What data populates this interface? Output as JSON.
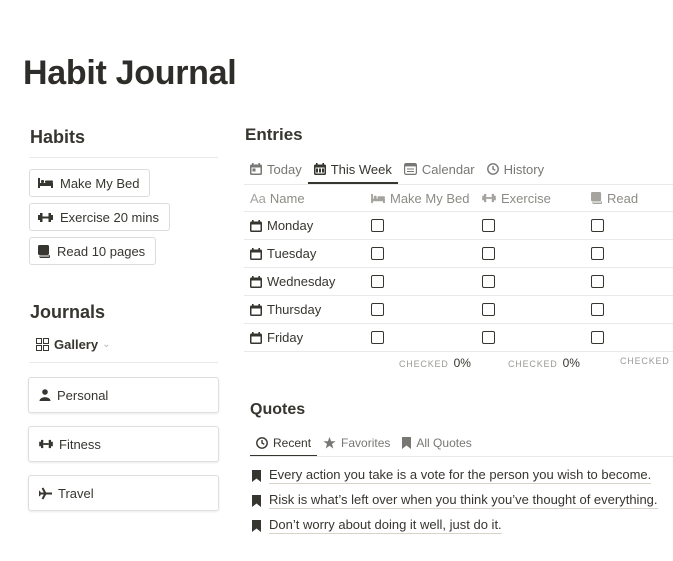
{
  "page": {
    "title": "Habit Journal"
  },
  "habits": {
    "heading": "Habits",
    "buttons": [
      {
        "label": "Make My Bed",
        "icon": "bed-icon"
      },
      {
        "label": "Exercise 20 mins",
        "icon": "dumbbell-icon"
      },
      {
        "label": "Read 10 pages",
        "icon": "book-icon"
      }
    ]
  },
  "journals": {
    "heading": "Journals",
    "view": "Gallery",
    "cards": [
      {
        "label": "Personal",
        "icon": "person-icon"
      },
      {
        "label": "Fitness",
        "icon": "dumbbell-icon"
      },
      {
        "label": "Travel",
        "icon": "airplane-icon"
      }
    ]
  },
  "entries": {
    "heading": "Entries",
    "tabs": [
      "Today",
      "This Week",
      "Calendar",
      "History"
    ],
    "active_tab": "This Week",
    "columns": [
      "Name",
      "Make My Bed",
      "Exercise",
      "Read"
    ],
    "name_prefix": "Aa",
    "rows": [
      {
        "name": "Monday",
        "make_my_bed": false,
        "exercise": false,
        "read": false
      },
      {
        "name": "Tuesday",
        "make_my_bed": false,
        "exercise": false,
        "read": false
      },
      {
        "name": "Wednesday",
        "make_my_bed": false,
        "exercise": false,
        "read": false
      },
      {
        "name": "Thursday",
        "make_my_bed": false,
        "exercise": false,
        "read": false
      },
      {
        "name": "Friday",
        "make_my_bed": false,
        "exercise": false,
        "read": false
      }
    ],
    "aggregates": [
      {
        "label": "CHECKED",
        "value": "0%"
      },
      {
        "label": "CHECKED",
        "value": "0%"
      },
      {
        "label": "CHECKED",
        "value": ""
      }
    ]
  },
  "quotes": {
    "heading": "Quotes",
    "tabs": [
      "Recent",
      "Favorites",
      "All Quotes"
    ],
    "active_tab": "Recent",
    "items": [
      "Every action you take is a vote for the person you wish to become.",
      "Risk is what’s left over when you think you’ve thought of everything.",
      "Don’t worry about doing it well, just do it."
    ]
  },
  "colors": {
    "text": "#37352f",
    "muted": "#787774",
    "divider": "#e9e9e7"
  }
}
